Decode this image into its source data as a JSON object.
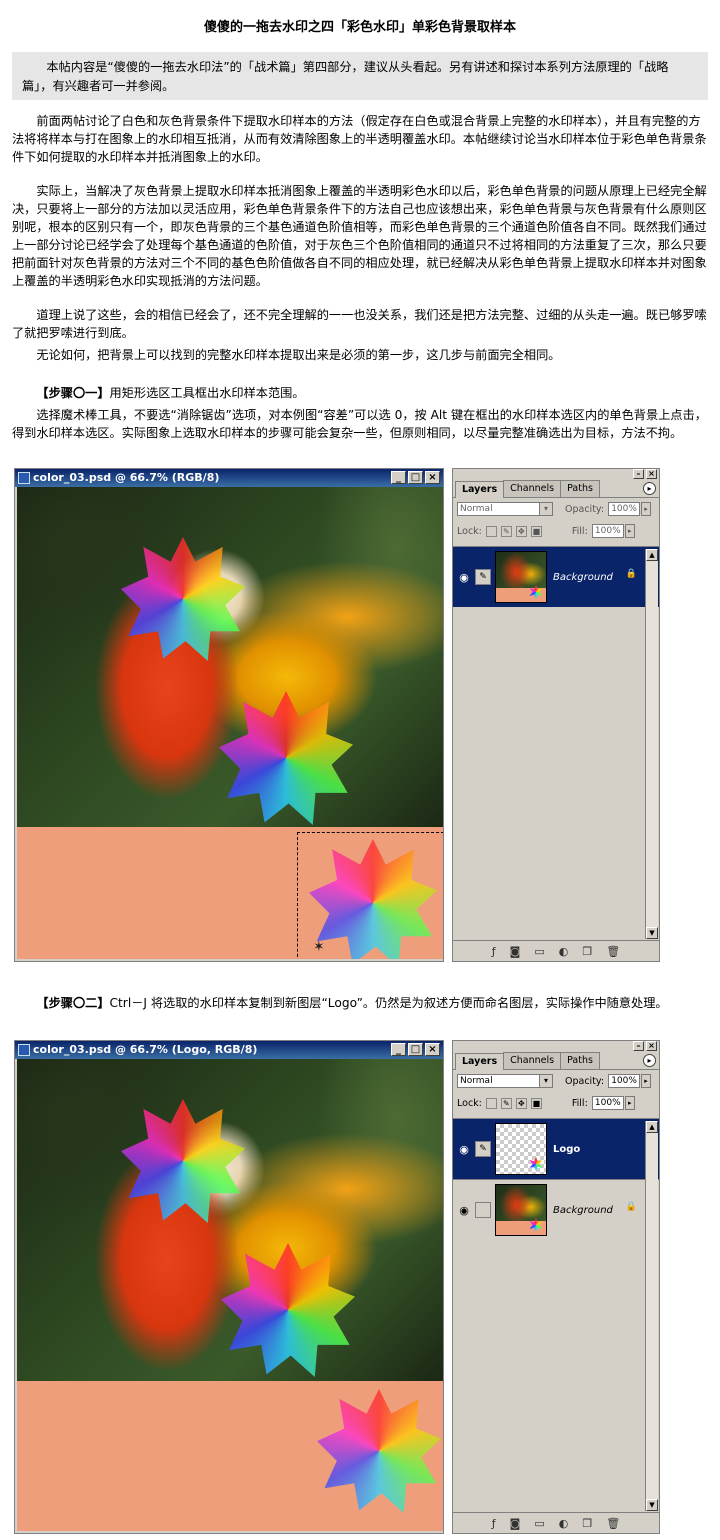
{
  "title": "傻傻的一拖去水印之四「彩色水印」单彩色背景取样本",
  "intro": "本帖内容是“傻傻的一拖去水印法”的「战术篇」第四部分，建议从头看起。另有讲述和探讨本系列方法原理的「战略篇」，有兴趣者可一并参阅。",
  "paragraphs": [
    "前面两帖讨论了白色和灰色背景条件下提取水印样本的方法（假定存在白色或混合背景上完整的水印样本），并且有完整的方法将将样本与打在图象上的水印相互抵消，从而有效清除图象上的半透明覆盖水印。本帖继续讨论当水印样本位于彩色单色背景条件下如何提取的水印样本并抵消图象上的水印。",
    "实际上，当解决了灰色背景上提取水印样本抵消图象上覆盖的半透明彩色水印以后，彩色单色背景的问题从原理上已经完全解决，只要将上一部分的方法加以灵活应用，彩色单色背景条件下的方法自己也应该想出来，彩色单色背景与灰色背景有什么原则区别呢，根本的区别只有一个，即灰色背景的三个基色通道色阶值相等，而彩色单色背景的三个通道色阶值各自不同。既然我们通过上一部分讨论已经学会了处理每个基色通道的色阶值，对于灰色三个色阶值相同的通道只不过将相同的方法重复了三次，那么只要把前面针对灰色背景的方法对三个不同的基色色阶值做各自不同的相应处理，就已经解决从彩色单色背景上提取水印样本并对图象上覆盖的半透明彩色水印实现抵消的方法问题。",
    "道理上说了这些，会的相信已经会了，还不完全理解的一一也没关系，我们还是把方法完整、过细的从头走一遍。既已够罗嗦了就把罗嗦进行到底。",
    "无论如何，把背景上可以找到的完整水印样本提取出来是必须的第一步，这几步与前面完全相同。"
  ],
  "step1": {
    "label": "【步骤〇一】",
    "text": "用矩形选区工具框出水印样本范围。",
    "body": "选择魔术棒工具，不要选“消除锯齿”选项，对本例图“容差”可以选 0，按 Alt 键在框出的水印样本选区内的单色背景上点击，得到水印样本选区。实际图象上选取水印样本的步骤可能会复杂一些，但原则相同，以尽量完整准确选出为目标，方法不拘。"
  },
  "step2": {
    "label": "【步骤〇二】",
    "text": "Ctrl－J 将选取的水印样本复制到新图层“Logo”。仍然是为叙述方便而命名图层，实际操作中随意处理。"
  },
  "window_buttons": [
    "_",
    "□",
    "×"
  ],
  "screens": [
    {
      "doc_title": "color_03.psd @ 66.7% (RGB/8)",
      "tabs": [
        "Layers",
        "Channels",
        "Paths"
      ],
      "blend_mode": "Normal",
      "opacity_label": "Opacity:",
      "opacity_value": "100%",
      "lock_label": "Lock:",
      "fill_label": "Fill:",
      "fill_value": "100%",
      "layers": [
        {
          "name": "Background",
          "active": true,
          "locked": true
        }
      ]
    },
    {
      "doc_title": "color_03.psd @ 66.7% (Logo, RGB/8)",
      "tabs": [
        "Layers",
        "Channels",
        "Paths"
      ],
      "blend_mode": "Normal",
      "opacity_label": "Opacity:",
      "opacity_value": "100%",
      "lock_label": "Lock:",
      "fill_label": "Fill:",
      "fill_value": "100%",
      "layers": [
        {
          "name": "Logo",
          "active": true,
          "locked": false
        },
        {
          "name": "Background",
          "active": false,
          "locked": true
        }
      ]
    }
  ]
}
